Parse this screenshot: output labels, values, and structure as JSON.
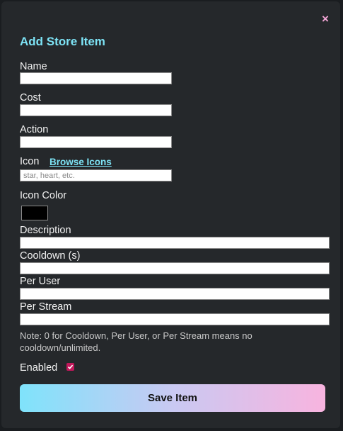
{
  "modal": {
    "title": "Add Store Item",
    "close_label": "×"
  },
  "fields": {
    "name": {
      "label": "Name",
      "value": "",
      "placeholder": ""
    },
    "cost": {
      "label": "Cost",
      "value": "",
      "placeholder": ""
    },
    "action": {
      "label": "Action",
      "value": "",
      "placeholder": ""
    },
    "icon": {
      "label": "Icon",
      "browse_link": "Browse Icons",
      "value": "",
      "placeholder": "star, heart, etc."
    },
    "icon_color": {
      "label": "Icon Color",
      "value": "#000000"
    },
    "description": {
      "label": "Description",
      "value": "",
      "placeholder": ""
    },
    "cooldown": {
      "label": "Cooldown (s)",
      "value": "",
      "placeholder": ""
    },
    "per_user": {
      "label": "Per User",
      "value": "",
      "placeholder": ""
    },
    "per_stream": {
      "label": "Per Stream",
      "value": "",
      "placeholder": ""
    }
  },
  "note": "Note: 0 for Cooldown, Per User, or Per Stream means no cooldown/unlimited.",
  "enabled": {
    "label": "Enabled",
    "checked": true
  },
  "save_label": "Save Item",
  "colors": {
    "background": "#25282b",
    "accent_title": "#7de3f5",
    "close": "#f4a6d7",
    "checkbox": "#c2185b",
    "button_gradient_start": "#7fe3fb",
    "button_gradient_end": "#f8b4df"
  },
  "icons": {
    "close": "close-icon",
    "check": "checkmark-icon"
  }
}
